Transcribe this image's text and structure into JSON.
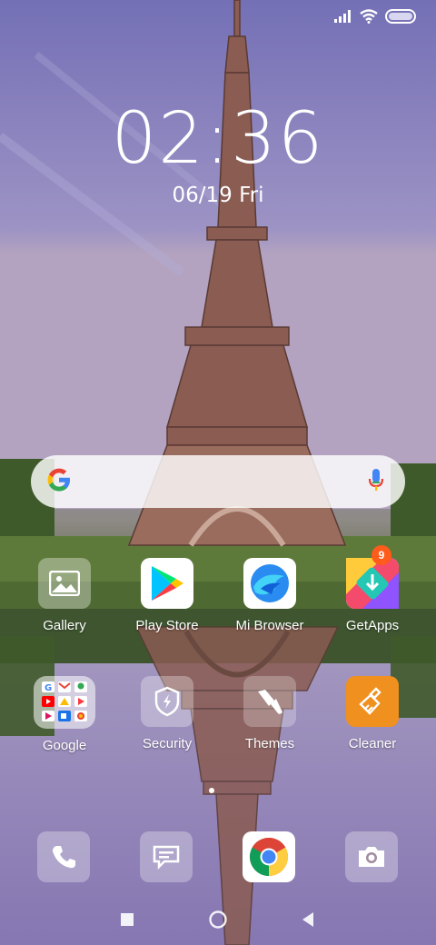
{
  "status_bar": {
    "icons": [
      "signal-icon",
      "wifi-icon",
      "battery-icon"
    ]
  },
  "clock": {
    "time": "02:36",
    "date": "06/19",
    "weekday": "Fri"
  },
  "search": {
    "logo": "google-g-icon",
    "mic": "mic-icon"
  },
  "apps_row1": [
    {
      "label": "Gallery",
      "icon": "gallery-icon"
    },
    {
      "label": "Play Store",
      "icon": "play-store-icon"
    },
    {
      "label": "Mi Browser",
      "icon": "mi-browser-icon"
    },
    {
      "label": "GetApps",
      "icon": "getapps-icon",
      "badge": "9"
    }
  ],
  "apps_row2": [
    {
      "label": "Google",
      "icon": "google-folder-icon"
    },
    {
      "label": "Security",
      "icon": "security-icon"
    },
    {
      "label": "Themes",
      "icon": "themes-icon"
    },
    {
      "label": "Cleaner",
      "icon": "cleaner-icon"
    }
  ],
  "dock": [
    {
      "icon": "phone-icon"
    },
    {
      "icon": "messages-icon"
    },
    {
      "icon": "chrome-icon"
    },
    {
      "icon": "camera-icon"
    }
  ],
  "navigation": {
    "buttons": [
      "recents-button",
      "home-button",
      "back-button"
    ]
  },
  "colors": {
    "badge": "#ff5b1a",
    "cleaner": "#f0901e",
    "getapps_teal": "#23c7b3"
  }
}
